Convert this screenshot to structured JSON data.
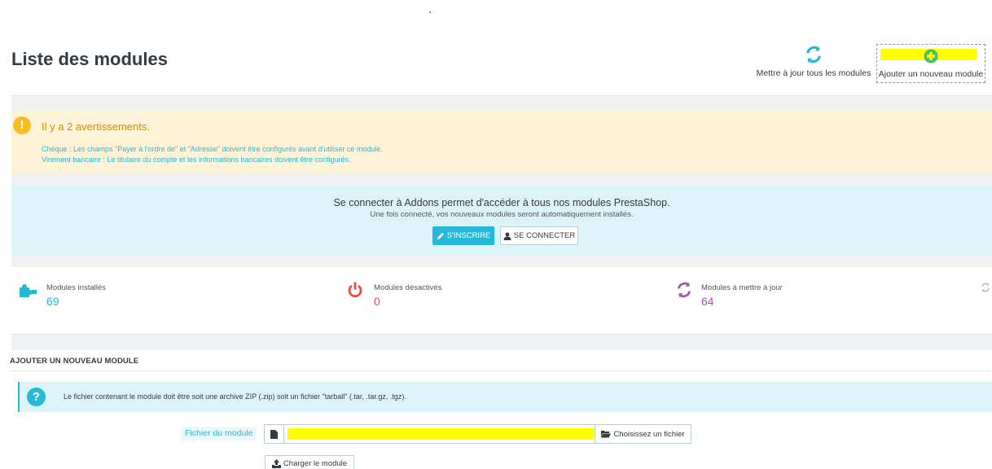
{
  "header": {
    "title": "Liste des modules",
    "update_all_label": "Mettre à jour tous les modules",
    "add_module_label": "Ajouter un nouveau module"
  },
  "warning": {
    "title": "Il y a 2 avertissements.",
    "lines": [
      "Chèque : Les champs \"Payer à l'ordre de\" et \"Adresse\" doivent être configurés avant d'utiliser ce module.",
      "Virement bancaire : Le titulaire du compte et les informations bancaires doivent être configurés."
    ]
  },
  "addons": {
    "title": "Se connecter à Addons permet d'accéder à tous nos modules PrestaShop.",
    "subtitle": "Une fois connecté, vos nouveaux modules seront automatiquement installés.",
    "signup_label": "S'INSCRIRE",
    "login_label": "SE CONNECTER"
  },
  "stats": {
    "installed": {
      "label": "Modules installés",
      "value": "69",
      "color": "#25b9d7"
    },
    "disabled": {
      "label": "Modules désactivés",
      "value": "0",
      "color": "#e84e3c"
    },
    "to_update": {
      "label": "Modules à mettre à jour",
      "value": "64",
      "color": "#a05ca8"
    }
  },
  "upload": {
    "section_title": "AJOUTER UN NOUVEAU MODULE",
    "info_text": "Le fichier contenant le module doit être soit une archive ZIP (.zip) soit un fichier \"tarball\" (.tar, .tar.gz, .tgz).",
    "file_label": "Fichier du module",
    "file_value": "",
    "choose_file_label": "Choisissez un fichier",
    "upload_button_label": "Charger le module"
  },
  "icons": {
    "update": "refresh-icon",
    "add": "plus-circle-icon",
    "warning": "exclamation-icon",
    "installed": "puzzle-icon",
    "disabled": "power-icon",
    "to_update": "refresh-icon",
    "info": "question-icon",
    "file": "file-icon",
    "folder": "folder-icon",
    "upload": "upload-icon"
  },
  "colors": {
    "accent": "#25b9d7",
    "warning_bg": "#fff3d7",
    "warning_title": "#d58e00",
    "add_icon": "#4cbb6c"
  }
}
